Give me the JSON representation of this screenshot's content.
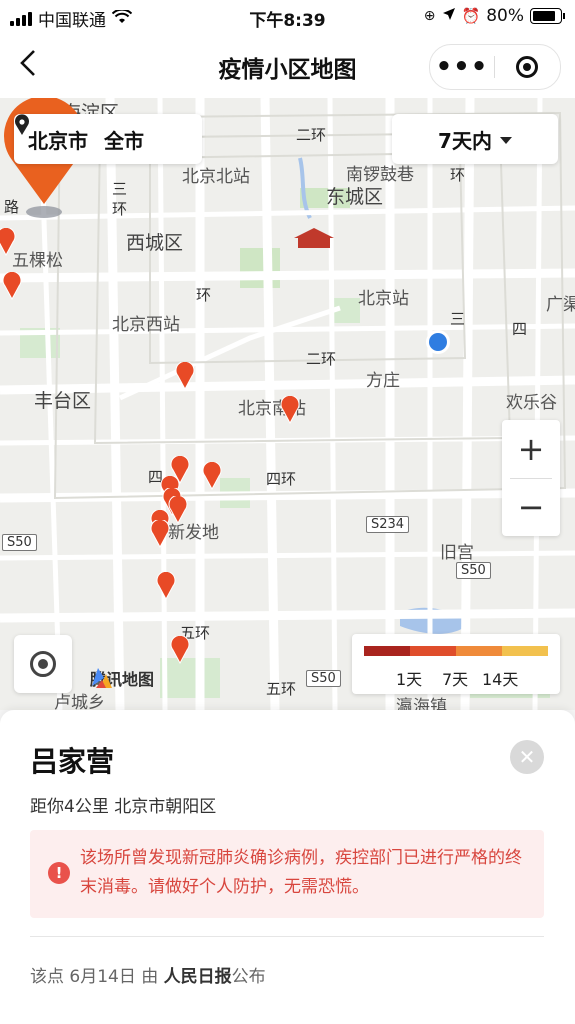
{
  "status_bar": {
    "carrier": "中国联通",
    "time": "下午8:39",
    "battery": "80%"
  },
  "nav": {
    "title": "疫情小区地图"
  },
  "filters": {
    "city": "北京市",
    "area": "全市",
    "range": "7天内"
  },
  "map": {
    "labels": {
      "haidian": "海淀区",
      "erhuan_top": "二环",
      "beijing_north": "北京北站",
      "nanluoguxiang": "南锣鼓巷",
      "dongcheng": "东城区",
      "huan": "环",
      "road_lu": "路",
      "san": "三",
      "huan2": "环",
      "xicheng": "西城区",
      "wukesong": "五棵松",
      "beijing_station": "北京站",
      "huan_diag": "环",
      "beijing_west": "北京西站",
      "guangqu": "广渠",
      "san_r": "三",
      "si_r": "四",
      "erhuan_mid": "二环",
      "fangzhuang": "方庄",
      "fengtai": "丰台区",
      "beijing_south": "北京南站",
      "huanle": "欢乐谷",
      "si_l": "四",
      "sihuan": "四环",
      "xinfadi": "新发地",
      "s234": "S234",
      "s50_left": "S50",
      "jiugong": "旧宫",
      "s50_right": "S50",
      "wuhuan": "五环",
      "wuhuan2": "五环",
      "s50_bottom": "S50",
      "lucheng": "卢城乡",
      "yinghaizhen": "瀛海镇",
      "logo": "腾讯地图"
    },
    "legend": [
      "1天",
      "7天",
      "14天"
    ],
    "legend_colors": [
      "#a9241e",
      "#df4d2b",
      "#ef8a3a",
      "#f2c14e"
    ],
    "zoom_in": "+",
    "zoom_out": "−"
  },
  "detail": {
    "name": "吕家营",
    "distance_area": "距你4公里  北京市朝阳区",
    "alert": "该场所曾发现新冠肺炎确诊病例，疾控部门已进行严格的终末消毒。请做好个人防护，无需恐慌。",
    "source_prefix": "该点 6月14日 由 ",
    "source_name": "人民日报",
    "source_suffix": "公布"
  }
}
